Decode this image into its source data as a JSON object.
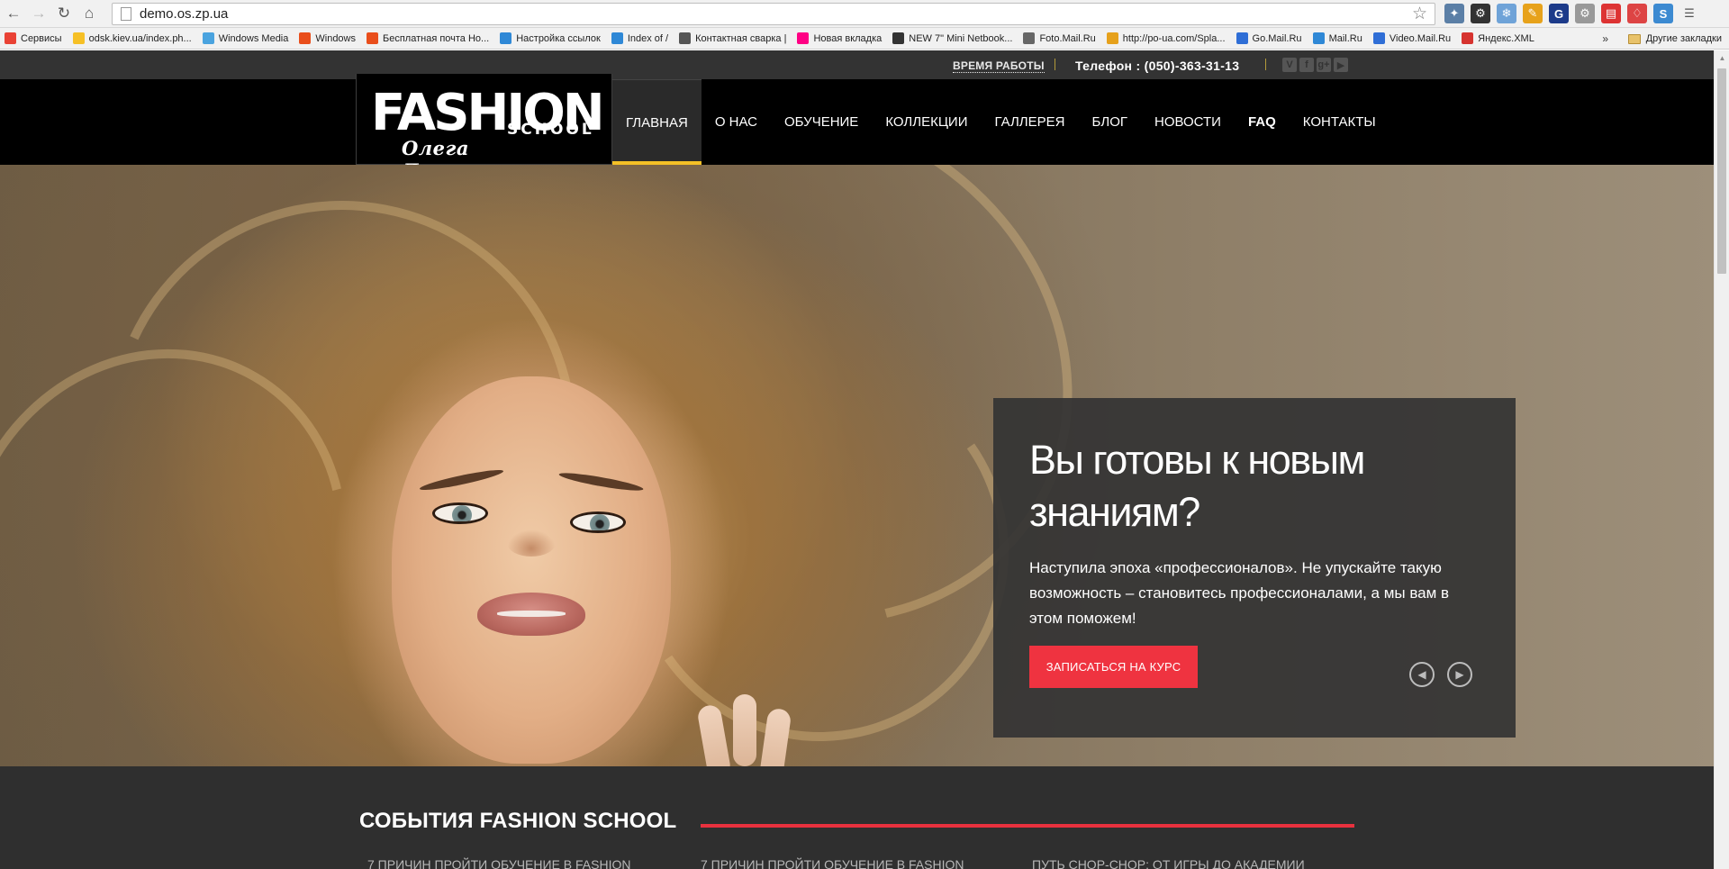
{
  "browser": {
    "url": "demo.os.zp.ua",
    "bookmarks": [
      {
        "label": "Сервисы",
        "color": "#e94235"
      },
      {
        "label": "odsk.kiev.ua/index.ph...",
        "color": "#f6c026"
      },
      {
        "label": "Windows Media",
        "color": "#4aa3df"
      },
      {
        "label": "Windows",
        "color": "#e94e1b"
      },
      {
        "label": "Бесплатная почта Ho...",
        "color": "#e94e1b"
      },
      {
        "label": "Настройка ссылок",
        "color": "#2f88d6"
      },
      {
        "label": "Index of /",
        "color": "#2f88d6"
      },
      {
        "label": "Контактная сварка |",
        "color": "#555555"
      },
      {
        "label": "Новая вкладка",
        "color": "#ff0084"
      },
      {
        "label": "NEW 7\" Mini Netbook...",
        "color": "#333333"
      },
      {
        "label": "Foto.Mail.Ru",
        "color": "#666666"
      },
      {
        "label": "http://po-ua.com/Spla...",
        "color": "#e6a11c"
      },
      {
        "label": "Go.Mail.Ru",
        "color": "#2f6ed6"
      },
      {
        "label": "Mail.Ru",
        "color": "#2f88d6"
      },
      {
        "label": "Video.Mail.Ru",
        "color": "#2f6ed6"
      },
      {
        "label": "Яндекс.XML",
        "color": "#d6332f"
      }
    ],
    "more_label": "»",
    "other_bookmarks": "Другие закладки"
  },
  "site": {
    "work_hours": "ВРЕМЯ РАБОТЫ",
    "phone_label": "Телефон :",
    "phone": "(050)-363-31-13",
    "socials": [
      "V",
      "f",
      "g+",
      "▶"
    ],
    "logo": {
      "fashion": "FASHION",
      "school": "SCHOOL",
      "signature": "Олега Даниильченко"
    },
    "menu": [
      {
        "label": "ГЛАВНАЯ",
        "active": true,
        "bold": false
      },
      {
        "label": "О НАС",
        "active": false,
        "bold": false
      },
      {
        "label": "ОБУЧЕНИЕ",
        "active": false,
        "bold": false
      },
      {
        "label": "КОЛЛЕКЦИИ",
        "active": false,
        "bold": false
      },
      {
        "label": "ГАЛЛЕРЕЯ",
        "active": false,
        "bold": false
      },
      {
        "label": "БЛОГ",
        "active": false,
        "bold": false
      },
      {
        "label": "НОВОСТИ",
        "active": false,
        "bold": false
      },
      {
        "label": "FAQ",
        "active": false,
        "bold": true
      },
      {
        "label": "КОНТАКТЫ",
        "active": false,
        "bold": false
      }
    ],
    "slide": {
      "title": "Вы готовы к новым знаниям?",
      "text": "Наступила эпоха «профессионалов». Не упускайте такую возможность – становитесь профессионалами, а мы вам в этом поможем!",
      "cta": "ЗАПИСАТЬСЯ НА КУРС",
      "prev_icon": "◀",
      "next_icon": "▶"
    },
    "events": {
      "title": "СОБЫТИЯ FASHION SCHOOL",
      "items": [
        "7 ПРИЧИН ПРОЙТИ ОБУЧЕНИЕ В FASHION",
        "7 ПРИЧИН ПРОЙТИ ОБУЧЕНИЕ В FASHION",
        "ПУТЬ CHOP-CHOP: ОТ ИГРЫ ДО АКАДЕМИИ"
      ]
    }
  },
  "colors": {
    "accent_yellow": "#f4c026",
    "accent_red": "#ef3340",
    "header_bg": "#000000",
    "dark_bg": "#2f2f2f"
  }
}
